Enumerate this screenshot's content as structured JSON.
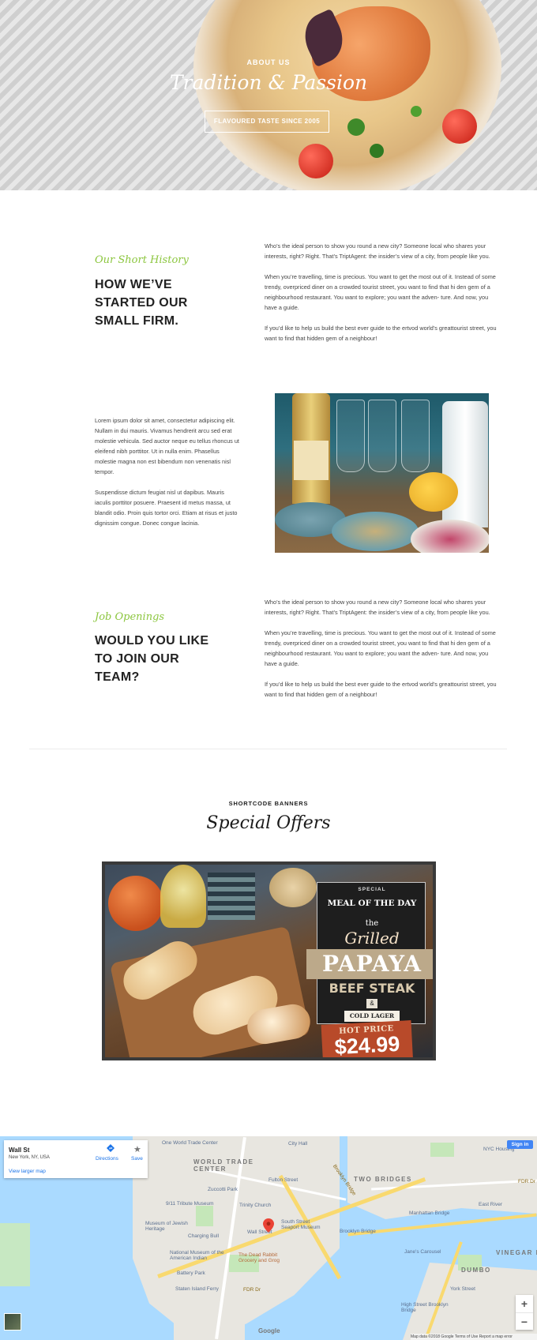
{
  "hero": {
    "subtitle": "ABOUT US",
    "title": "Tradition & Passion",
    "button_label": "FLAVOURED TASTE SINCE 2005"
  },
  "history": {
    "script": "Our Short History",
    "heading": "HOW WE’VE STARTED OUR SMALL FIRM.",
    "p1": "Who’s the ideal person to show you round a new city? Someone local who shares your interests, right? Right. That’s TriptAgent: the insider’s view of a city, from people like you.",
    "p2": "When you’re travelling, time is precious. You want to get the most out of it. Instead of some trendy, overpriced diner on a crowded tourist street, you want to find that hi den gem of a neighbourhood restaurant. You want to explore; you want the adven- ture. And now, you have a guide.",
    "p3": "If you’d like to help us build the best ever guide to the ertvod world’s greattourist street, you want to find that hidden gem of a neighbour!"
  },
  "about": {
    "p1": "Lorem ipsum dolor sit amet, consectetur adipiscing elit. Nullam in dui mauris. Vivamus hendrerit arcu sed erat molestie vehicula. Sed auctor neque eu tellus rhoncus ut eleifend nibh porttitor. Ut in nulla enim. Phasellus molestie magna non est bibendum non venenatis nisl tempor.",
    "p2": "Suspendisse dictum feugiat nisl ut dapibus. Mauris iaculis porttitor posuere. Praesent id metus massa, ut blandit odio. Proin quis tortor orci. Etiam at risus et justo dignissim congue. Donec congue lacinia."
  },
  "jobs": {
    "script": "Job Openings",
    "heading": "WOULD YOU LIKE TO JOIN OUR TEAM?",
    "p1": "Who’s the ideal person to show you round a new city? Someone local who shares your interests, right? Right. That’s TriptAgent: the insider’s view of a city, from people like you.",
    "p2": "When you’re travelling, time is precious. You want to get the most out of it. Instead of some trendy, overpriced diner on a crowded tourist street, you want to find that hi den gem of a neighbourhood restaurant. You want to explore; you want the adven- ture. And now, you have a guide.",
    "p3": "If you’d like to help us build the best ever guide to the ertvod world’s greattourist street, you want to find that hidden gem of a neighbour!"
  },
  "shortcode": {
    "label": "SHORTCODE BANNERS",
    "title": "Special Offers"
  },
  "banner": {
    "special": "SPECIAL",
    "meal_of_the_day": "MEAL OF THE DAY",
    "the": "the",
    "grilled": "Grilled",
    "papaya": "PAPAYA",
    "beef_steak": "BEEF STEAK",
    "amp": "&",
    "cold_lager": "COLD LAGER",
    "hot_price": "HOT PRICE",
    "price": "$24.99"
  },
  "map": {
    "place_title": "Wall St",
    "place_address": "New York, NY, USA",
    "view_larger": "View larger map",
    "directions": "Directions",
    "save": "Save",
    "sign_in": "Sign in",
    "zoom_in": "+",
    "zoom_out": "−",
    "google": "Google",
    "footer": "Map data ©2018 Google   Terms of Use   Report a map error",
    "labels": {
      "one_wtc": "One World Trade Center",
      "city_hall": "City Hall",
      "nyc_housing": "NYC Housing",
      "wtc": "WORLD TRADE CENTER",
      "two_bridges": "TWO BRIDGES",
      "fulton": "Fulton Street",
      "zuccotti": "Zuccotti Park",
      "tribute": "9/11 Tribute Museum",
      "trinity": "Trinity Church",
      "manhattan_bridge": "Manhattan Bridge",
      "wall_st": "Wall Street",
      "seaport": "South Street Seaport Museum",
      "brooklyn_bridge": "Brooklyn Bridge",
      "jewish": "Museum of Jewish Heritage",
      "charging_bull": "Charging Bull",
      "nmai": "National Museum of the American Indian",
      "dead_rabbit": "The Dead Rabbit Grocery and Grog",
      "battery": "Battery Park",
      "staten": "Staten Island Ferry",
      "dumbo": "DUMBO",
      "vinegar": "VINEGAR HI",
      "east_river": "East River",
      "jane": "Jane's Carousel",
      "york_st": "York Street",
      "high_st": "High Street Brooklyn Bridge",
      "fdr1": "FDR Dr",
      "fdr2": "FDR Dr",
      "brooklyn_br_label": "Brooklyn Bridge"
    }
  }
}
